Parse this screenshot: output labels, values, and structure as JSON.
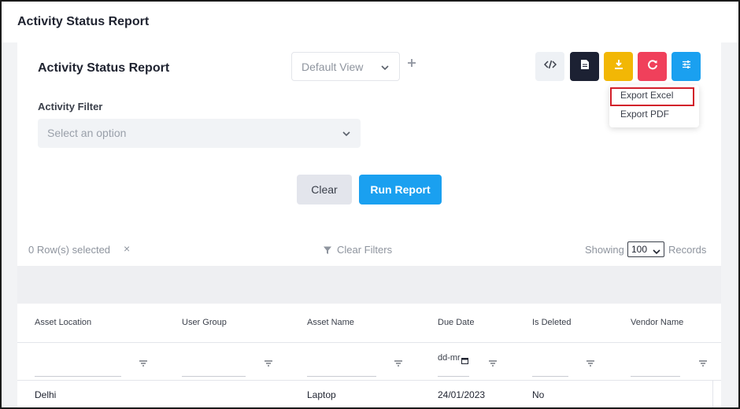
{
  "app": {
    "title": "Activity Status Report"
  },
  "report": {
    "title": "Activity Status Report",
    "view_select": "Default View",
    "add_view_icon": "plus-icon",
    "toolbar": {
      "code_icon": "code-icon",
      "doc_icon": "document-icon",
      "download_icon": "download-icon",
      "refresh_icon": "refresh-icon",
      "settings_icon": "sliders-icon"
    },
    "export_menu": {
      "items": [
        "Export Excel",
        "Export PDF"
      ],
      "highlighted": "Export Excel"
    },
    "filter": {
      "label": "Activity Filter",
      "placeholder": "Select an option"
    },
    "actions": {
      "clear": "Clear",
      "run": "Run Report"
    }
  },
  "grid": {
    "rows_selected": "0 Row(s) selected",
    "rows_selected_clear": "×",
    "clear_filters": "Clear Filters",
    "showing": "Showing",
    "page_size": "100",
    "records": "Records",
    "columns": [
      "Asset Location",
      "User Group",
      "Asset Name",
      "Due Date",
      "Is Deleted",
      "Vendor Name"
    ],
    "date_placeholder": "dd-mr",
    "rows": [
      [
        "Delhi",
        "",
        "Laptop",
        "24/01/2023",
        "No",
        ""
      ]
    ]
  },
  "colors": {
    "primary": "#1aa0f0",
    "dark": "#1c2133",
    "warning": "#f2b705",
    "danger": "#f0405b",
    "highlight_border": "#d21f2a"
  }
}
